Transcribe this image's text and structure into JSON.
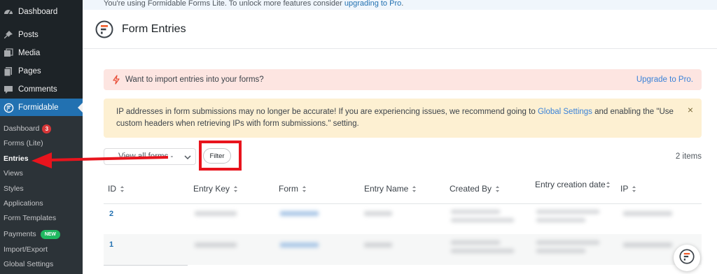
{
  "sidebar": {
    "menu": [
      {
        "label": "Dashboard",
        "icon": "dashboard-icon"
      },
      {
        "label": "Posts",
        "icon": "pin-icon"
      },
      {
        "label": "Media",
        "icon": "media-icon"
      },
      {
        "label": "Pages",
        "icon": "pages-icon"
      },
      {
        "label": "Comments",
        "icon": "comments-icon"
      },
      {
        "label": "Formidable",
        "icon": "formidable-icon"
      }
    ],
    "submenu": [
      {
        "label": "Dashboard",
        "badge": "3"
      },
      {
        "label": "Forms (Lite)"
      },
      {
        "label": "Entries"
      },
      {
        "label": "Views"
      },
      {
        "label": "Styles"
      },
      {
        "label": "Applications"
      },
      {
        "label": "Form Templates"
      },
      {
        "label": "Payments",
        "badge": "NEW"
      },
      {
        "label": "Import/Export"
      },
      {
        "label": "Global Settings"
      }
    ]
  },
  "banner": {
    "text": "You're using Formidable Forms Lite. To unlock more features consider ",
    "link": "upgrading to Pro",
    "suffix": "."
  },
  "header": {
    "title": "Form Entries"
  },
  "import_notice": {
    "text": "Want to import entries into your forms?",
    "link": "Upgrade to Pro."
  },
  "ip_notice": {
    "text_before": "IP addresses in form submissions may no longer be accurate! If you are experiencing issues, we recommend going to ",
    "link": "Global Settings",
    "text_after": " and enabling the \"Use custom headers when retrieving IPs with form submissions.\" setting.",
    "close": "×"
  },
  "filters": {
    "select_value": "View all forms -",
    "filter_label": "Filter",
    "items_count": "2 items"
  },
  "table": {
    "columns": [
      "ID",
      "Entry Key",
      "Form",
      "Entry Name",
      "Created By",
      "Entry creation date",
      "IP"
    ],
    "rows": [
      {
        "id": "2"
      },
      {
        "id": "1"
      }
    ]
  },
  "colors": {
    "accent": "#2271b1",
    "highlight": "#e8141d",
    "sidebar": "#1d2327"
  }
}
